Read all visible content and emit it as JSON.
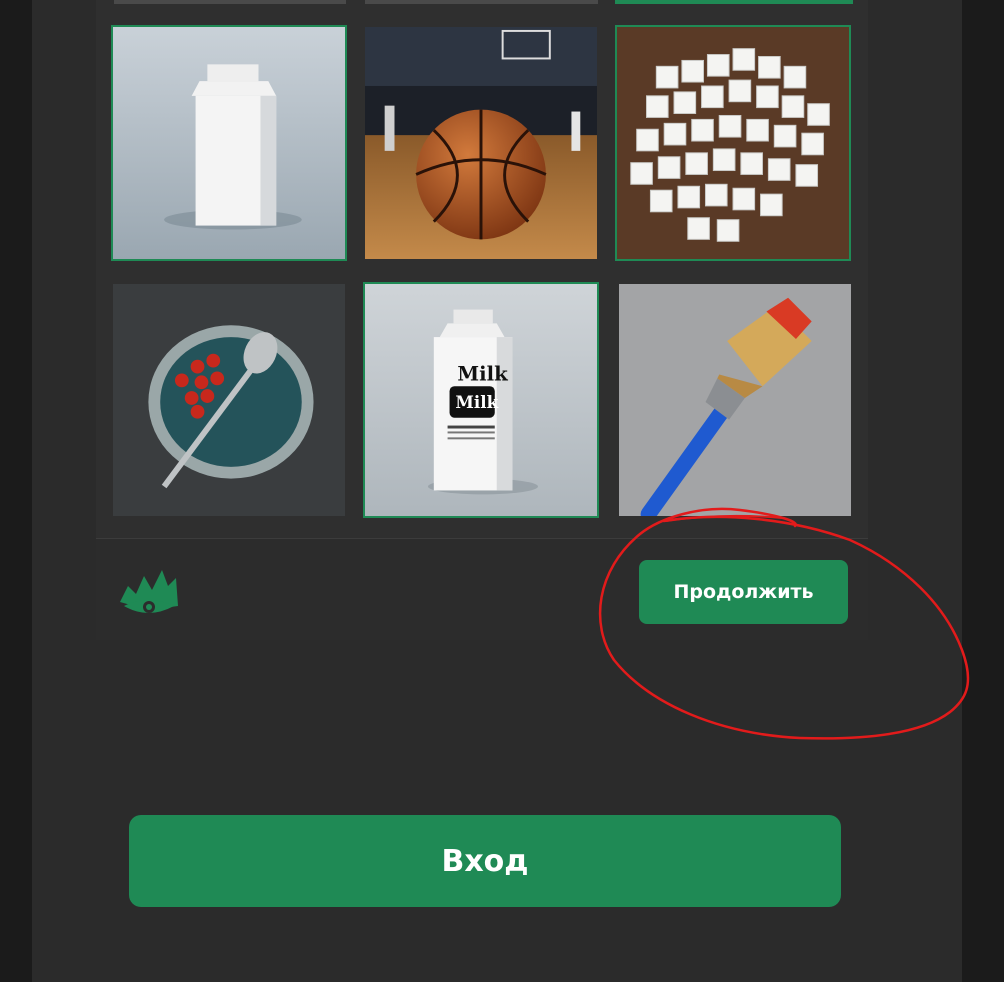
{
  "captcha": {
    "tiles": [
      {
        "name": "milk-carton-white",
        "selected": true
      },
      {
        "name": "basketball-on-court",
        "selected": false
      },
      {
        "name": "sugar-cubes",
        "selected": true
      },
      {
        "name": "tomatoes-in-bowl-with-spoon",
        "selected": false
      },
      {
        "name": "milk-carton-labeled",
        "selected": true,
        "label_top": "Milk",
        "label_bottom": "Milk"
      },
      {
        "name": "paint-brush",
        "selected": false
      }
    ],
    "continue_label": "Продолжить"
  },
  "login": {
    "label": "Вход"
  },
  "colors": {
    "accent": "#1f8a55",
    "annotation": "#e21b1b",
    "background": "#262626"
  },
  "icons": {
    "logo": "eye-logo-icon"
  }
}
